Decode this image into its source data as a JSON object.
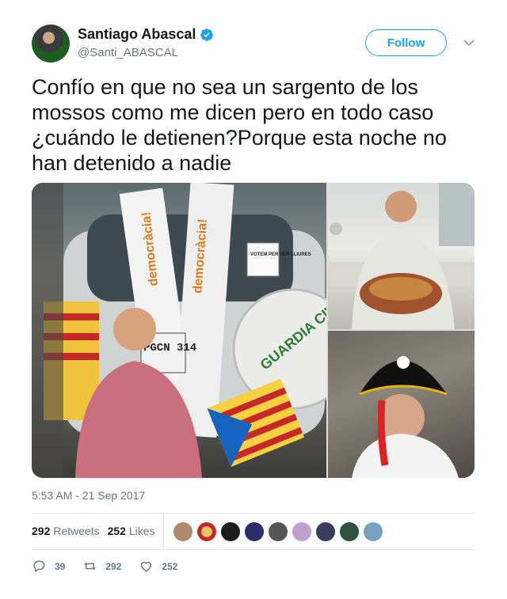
{
  "author": {
    "name": "Santiago Abascal",
    "handle": "@Santi_ABASCAL",
    "verified_icon": "verified-badge-icon",
    "accent": "#1da1f2"
  },
  "follow_label": "Follow",
  "tweet": {
    "text": "Confío en que no sea un sargento de los mossos como me dicen pero en todo caso ¿cuándo le detienen?Porque esta noche no han detenido a nadie",
    "timestamp": "5:53 AM - 21 Sep 2017"
  },
  "media": {
    "main_signs": [
      "democràcia!",
      "democràcia!",
      "VOTEM PER SER LLIURES"
    ],
    "vehicle_text": "GUARDIA CIVIL",
    "plate_text": "PGCN 314"
  },
  "stats": {
    "retweets_count": "292",
    "retweets_label": "Retweets",
    "likes_count": "252",
    "likes_label": "Likes"
  },
  "likers": [
    {
      "color": "#b08968"
    },
    {
      "color": "#e9c46a"
    },
    {
      "color": "#1d1d1d"
    },
    {
      "color": "#2b2d6b"
    },
    {
      "color": "#555555"
    },
    {
      "color": "#c0a0d0"
    },
    {
      "color": "#3c3c5c"
    },
    {
      "color": "#2f4f3f"
    },
    {
      "color": "#7aa0c0"
    }
  ],
  "actions": {
    "reply_count": "39",
    "retweet_count": "292",
    "like_count": "252"
  }
}
